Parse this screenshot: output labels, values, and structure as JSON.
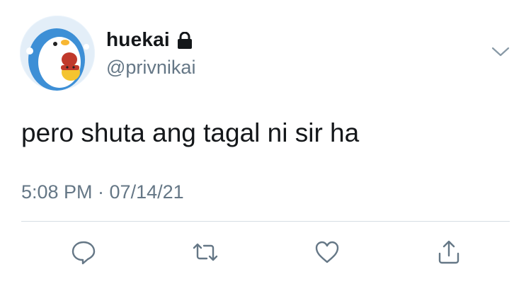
{
  "tweet": {
    "display_name": "huekai",
    "handle": "@privnikai",
    "text": "pero shuta ang tagal ni sir ha",
    "timestamp": "5:08 PM · 07/14/21",
    "protected_icon": "lock-icon",
    "menu_icon": "chevron-down-icon"
  },
  "actions": [
    {
      "name": "reply",
      "icon": "comment-icon"
    },
    {
      "name": "retweet",
      "icon": "retweet-icon"
    },
    {
      "name": "like",
      "icon": "heart-icon"
    },
    {
      "name": "share",
      "icon": "share-icon"
    }
  ],
  "colors": {
    "text": "#14171a",
    "secondary": "#657786",
    "divider": "#d6dde3",
    "icon": "#657786"
  }
}
